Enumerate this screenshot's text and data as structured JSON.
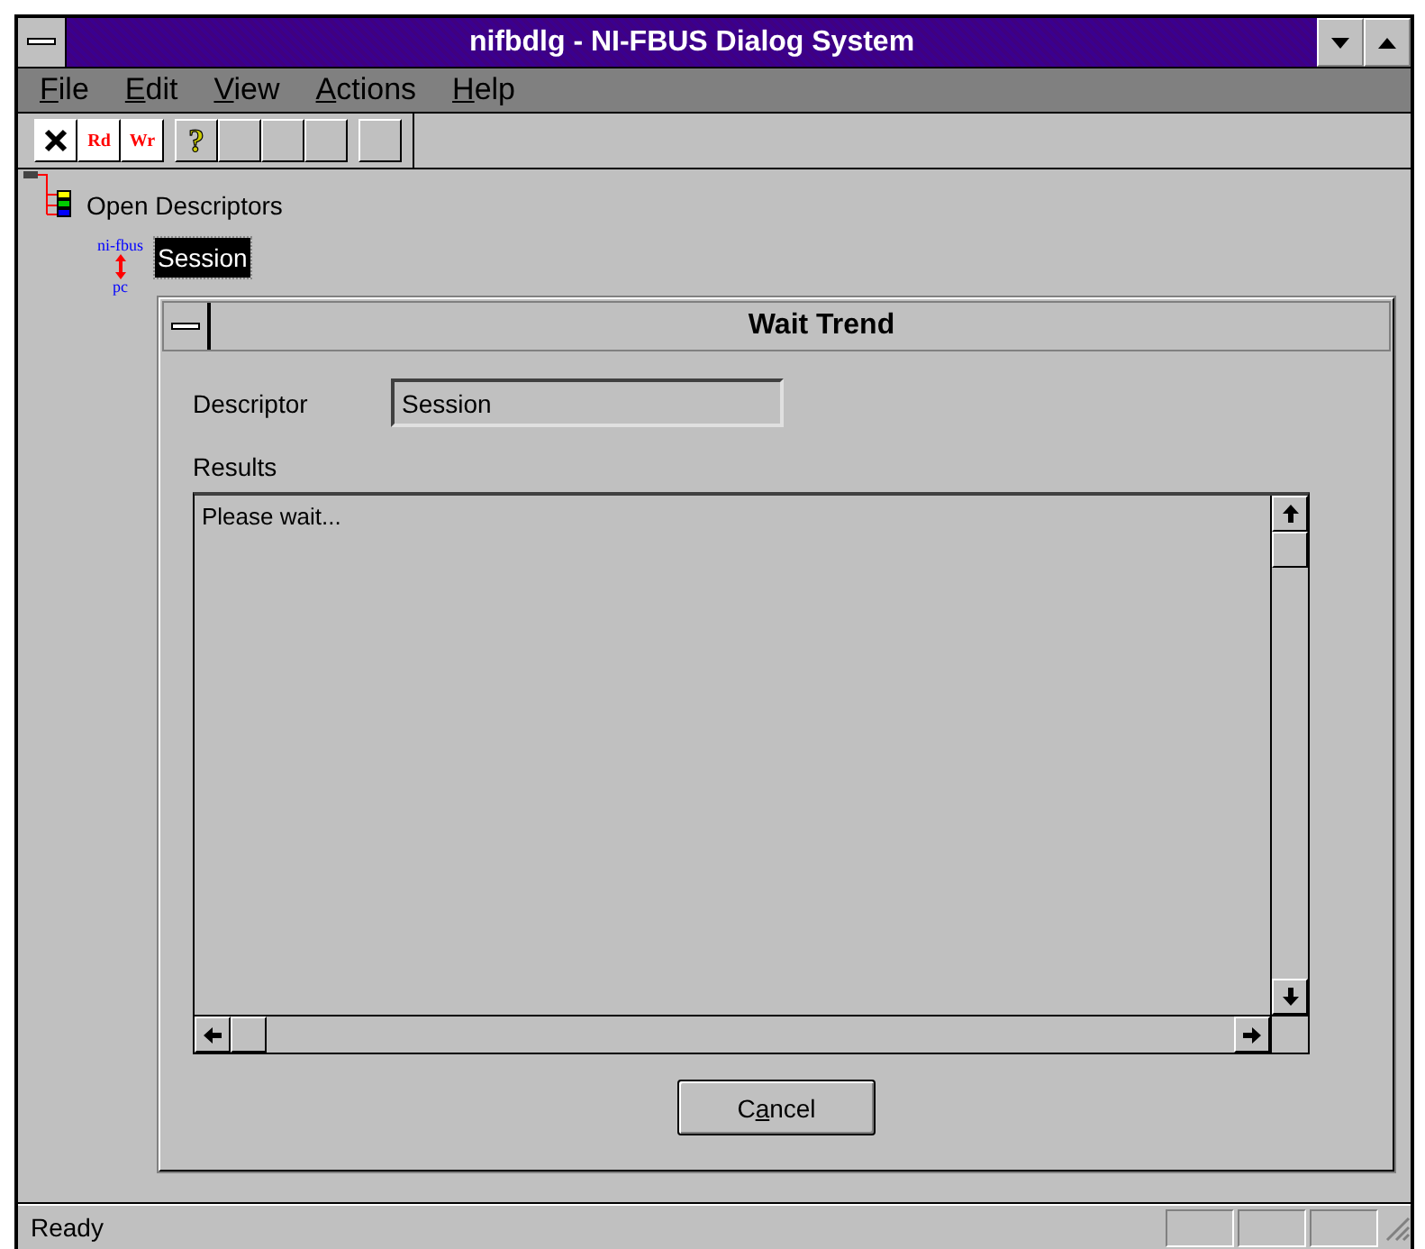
{
  "window": {
    "title": "nifbdlg - NI-FBUS Dialog System"
  },
  "menu": [
    {
      "parts": [
        {
          "text": "F",
          "underlined": true
        },
        {
          "text": "ile",
          "underlined": false
        }
      ]
    },
    {
      "parts": [
        {
          "text": "E",
          "underlined": true
        },
        {
          "text": "dit",
          "underlined": false
        }
      ]
    },
    {
      "parts": [
        {
          "text": "V",
          "underlined": true
        },
        {
          "text": "iew",
          "underlined": false
        }
      ]
    },
    {
      "parts": [
        {
          "text": "A",
          "underlined": true
        },
        {
          "text": "ctions",
          "underlined": false
        }
      ]
    },
    {
      "parts": [
        {
          "text": "H",
          "underlined": true
        },
        {
          "text": "elp",
          "underlined": false
        }
      ]
    }
  ],
  "toolbar": [
    {
      "kind": "close"
    },
    {
      "kind": "text",
      "label": "Rd"
    },
    {
      "kind": "text",
      "label": "Wr"
    },
    {
      "kind": "help",
      "label": "?"
    },
    {
      "kind": "blank"
    },
    {
      "kind": "blank"
    },
    {
      "kind": "blank"
    },
    {
      "kind": "blank"
    }
  ],
  "tree": {
    "label": "Open Descriptors",
    "children": [
      {
        "top": "ni-fbus",
        "bottom": "pc",
        "label": "Session",
        "selected": true
      }
    ]
  },
  "dialog": {
    "title": "Wait Trend",
    "descriptor_label": "Descriptor",
    "descriptor_value": "Session",
    "results_label": "Results",
    "results_text": "Please wait...",
    "button": {
      "parts": [
        {
          "text": "C",
          "underlined": false
        },
        {
          "text": "a",
          "underlined": true
        },
        {
          "text": "ncel",
          "underlined": false
        }
      ]
    }
  },
  "status_bar": {
    "text": "Ready"
  }
}
